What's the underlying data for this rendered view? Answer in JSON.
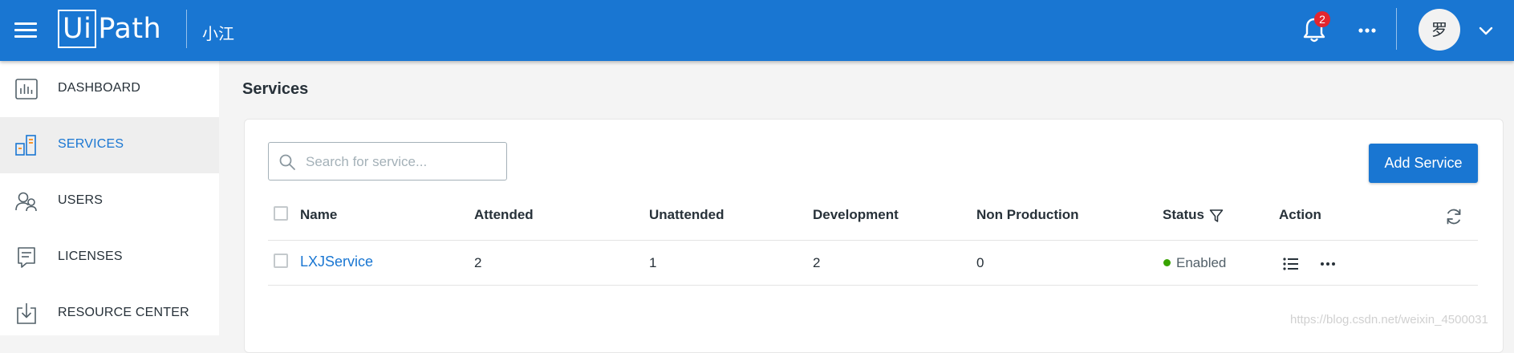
{
  "header": {
    "logo_boxed": "Ui",
    "logo_rest": "Path",
    "tenant": "小江",
    "notification_count": "2",
    "avatar_initial": "罗",
    "icons": [
      "menu-icon",
      "bell-icon",
      "more-horizontal-icon",
      "chevron-down-icon"
    ]
  },
  "sidebar": {
    "items": [
      {
        "label": "DASHBOARD",
        "icon": "dashboard-chart-icon"
      },
      {
        "label": "SERVICES",
        "icon": "services-icon",
        "active": true
      },
      {
        "label": "USERS",
        "icon": "users-icon"
      },
      {
        "label": "LICENSES",
        "icon": "license-icon"
      },
      {
        "label": "RESOURCE CENTER",
        "icon": "download-icon"
      }
    ]
  },
  "page": {
    "title": "Services",
    "search_placeholder": "Search for service...",
    "add_button": "Add Service"
  },
  "table": {
    "columns": [
      "Name",
      "Attended",
      "Unattended",
      "Development",
      "Non Production",
      "Status",
      "Action"
    ],
    "rows": [
      {
        "name": "LXJService",
        "attended": "2",
        "unattended": "1",
        "development": "2",
        "non_production": "0",
        "status": "Enabled"
      }
    ]
  },
  "watermark": "https://blog.csdn.net/weixin_4500031",
  "colors": {
    "brand": "#1976d2",
    "status_enabled": "#38a300",
    "badge": "#e3252e"
  }
}
